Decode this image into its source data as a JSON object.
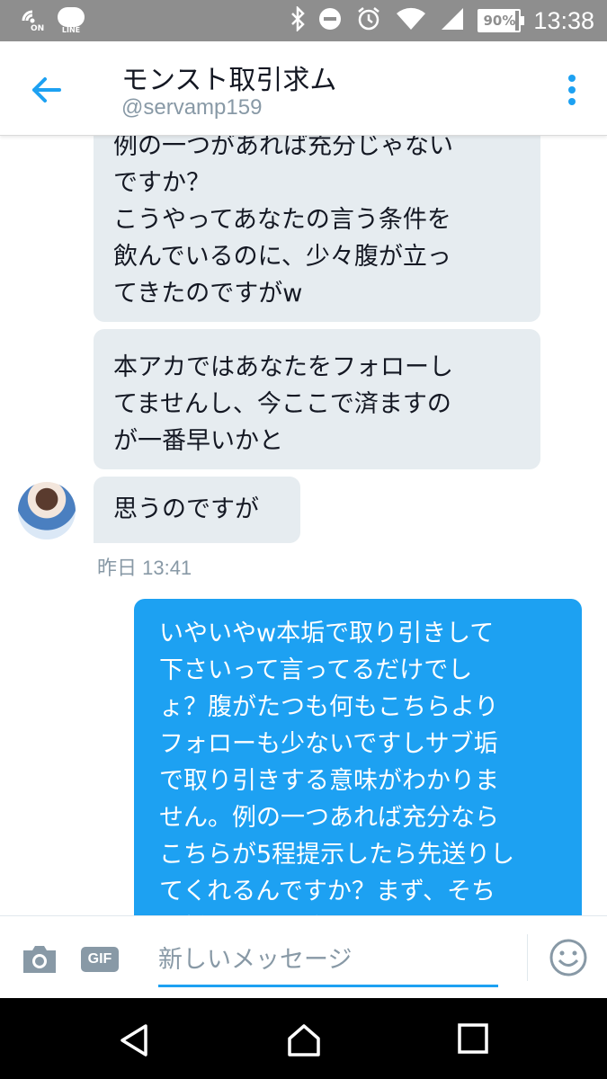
{
  "status_bar": {
    "carrier_icons": [
      "nfc-on-icon",
      "line-app-icon"
    ],
    "nfc_label": "ON",
    "line_label": "LINE",
    "battery_percent": 90,
    "battery_label": "90%",
    "time": "13:38"
  },
  "header": {
    "title": "モンスト取引求ム",
    "handle": "@servamp159"
  },
  "messages": [
    {
      "side": "in",
      "text": "例の一つがあれば充分じゃない\nですか？\nこうやってあなたの言う条件を\n飲んでいるのに、少々腹が立っ\nてきたのですがw"
    },
    {
      "side": "in",
      "text": "本アカではあなたをフォローし\nてませんし、今ここで済ますの\nが一番早いかと"
    },
    {
      "side": "in",
      "text": "思うのですが"
    },
    {
      "side": "out",
      "text": "いやいやw本垢で取り引きして\n下さいって言ってるだけでし\nょ？腹がたつも何もこちらより\nフォローも少ないですしサブ垢\nで取り引きする意味がわかりま\nせん。例の一つあれば充分なら\nこちらが5程提示したら先送りし\nてくれるんですか？まず、そち\nら様からの提案なのでしたらそ"
    }
  ],
  "timestamp": "昨日 13:41",
  "composer": {
    "gif_label": "GIF",
    "placeholder": "新しいメッセージ"
  },
  "colors": {
    "accent": "#1da1f2",
    "incoming_bubble": "#e6ecf0",
    "status_bar": "#8e8e8e"
  }
}
